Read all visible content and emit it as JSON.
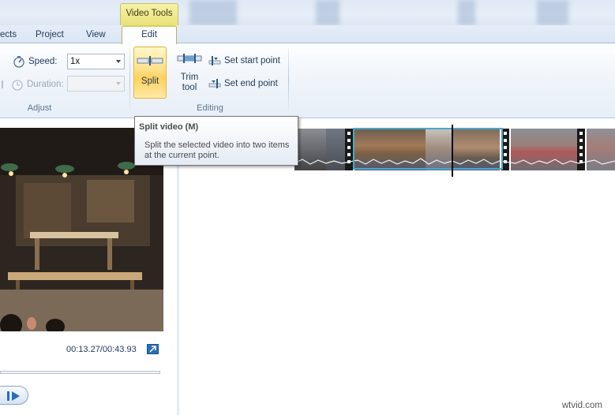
{
  "ribbon_tabs": {
    "partial_left": "ects",
    "project": "Project",
    "view": "View",
    "context_group": "Video Tools",
    "edit": "Edit"
  },
  "adjust": {
    "speed_label": "Speed:",
    "speed_value": "1x",
    "duration_label": "Duration:",
    "duration_value": "",
    "group_label": "Adjust"
  },
  "editing": {
    "split_label": "Split",
    "trim_label_1": "Trim",
    "trim_label_2": "tool",
    "set_start_label": "Set start point",
    "set_end_label": "Set end point",
    "group_label": "Editing"
  },
  "tooltip": {
    "title": "Split video (M)",
    "body": "Split the selected video into two items at the current point."
  },
  "preview": {
    "time": "00:13.27/00:43.93"
  },
  "watermark": "wtvid.com",
  "colors": {
    "ribbon_bg": "#f2f6fb",
    "context_tab": "#e9e27a",
    "split_highlight": "#ffd25c",
    "selected_clip_border": "#4aa7c9",
    "expand_icon": "#2b6db8"
  },
  "icons": {
    "speed": "speedometer-icon",
    "duration": "clock-icon",
    "split": "split-icon",
    "trim": "trim-icon",
    "set_start": "set-start-icon",
    "set_end": "set-end-icon",
    "expand": "expand-icon",
    "play": "play-icon"
  }
}
